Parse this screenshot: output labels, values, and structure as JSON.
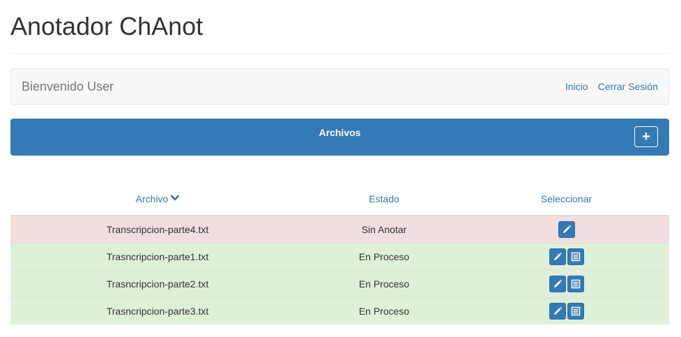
{
  "app": {
    "title": "Anotador ChAnot"
  },
  "navbar": {
    "welcome": "Bienvenido User",
    "links": [
      "Inicio",
      "Cerrar Sesión"
    ]
  },
  "panel": {
    "title": "Archivos",
    "add_icon": "plus-icon"
  },
  "table": {
    "headers": [
      "Archivo",
      "Estado",
      "Seleccionar"
    ],
    "sort_icon": "chevron-down-icon",
    "rows": [
      {
        "file": "Transcripcion-parte4.txt",
        "state": "Sin Anotar",
        "status": "danger",
        "actions": [
          "pencil-icon"
        ]
      },
      {
        "file": "Trasncripcion-parte1.txt",
        "state": "En Proceso",
        "status": "success",
        "actions": [
          "pencil-icon",
          "list-icon"
        ]
      },
      {
        "file": "Trasncripcion-parte2.txt",
        "state": "En Proceso",
        "status": "success",
        "actions": [
          "pencil-icon",
          "list-icon"
        ]
      },
      {
        "file": "Trasncripcion-parte3.txt",
        "state": "En Proceso",
        "status": "success",
        "actions": [
          "pencil-icon",
          "list-icon"
        ]
      }
    ]
  },
  "colors": {
    "primary": "#337ab7",
    "danger_row": "#f2dede",
    "success_row": "#dff0d8",
    "navbar_bg": "#f8f8f8"
  }
}
